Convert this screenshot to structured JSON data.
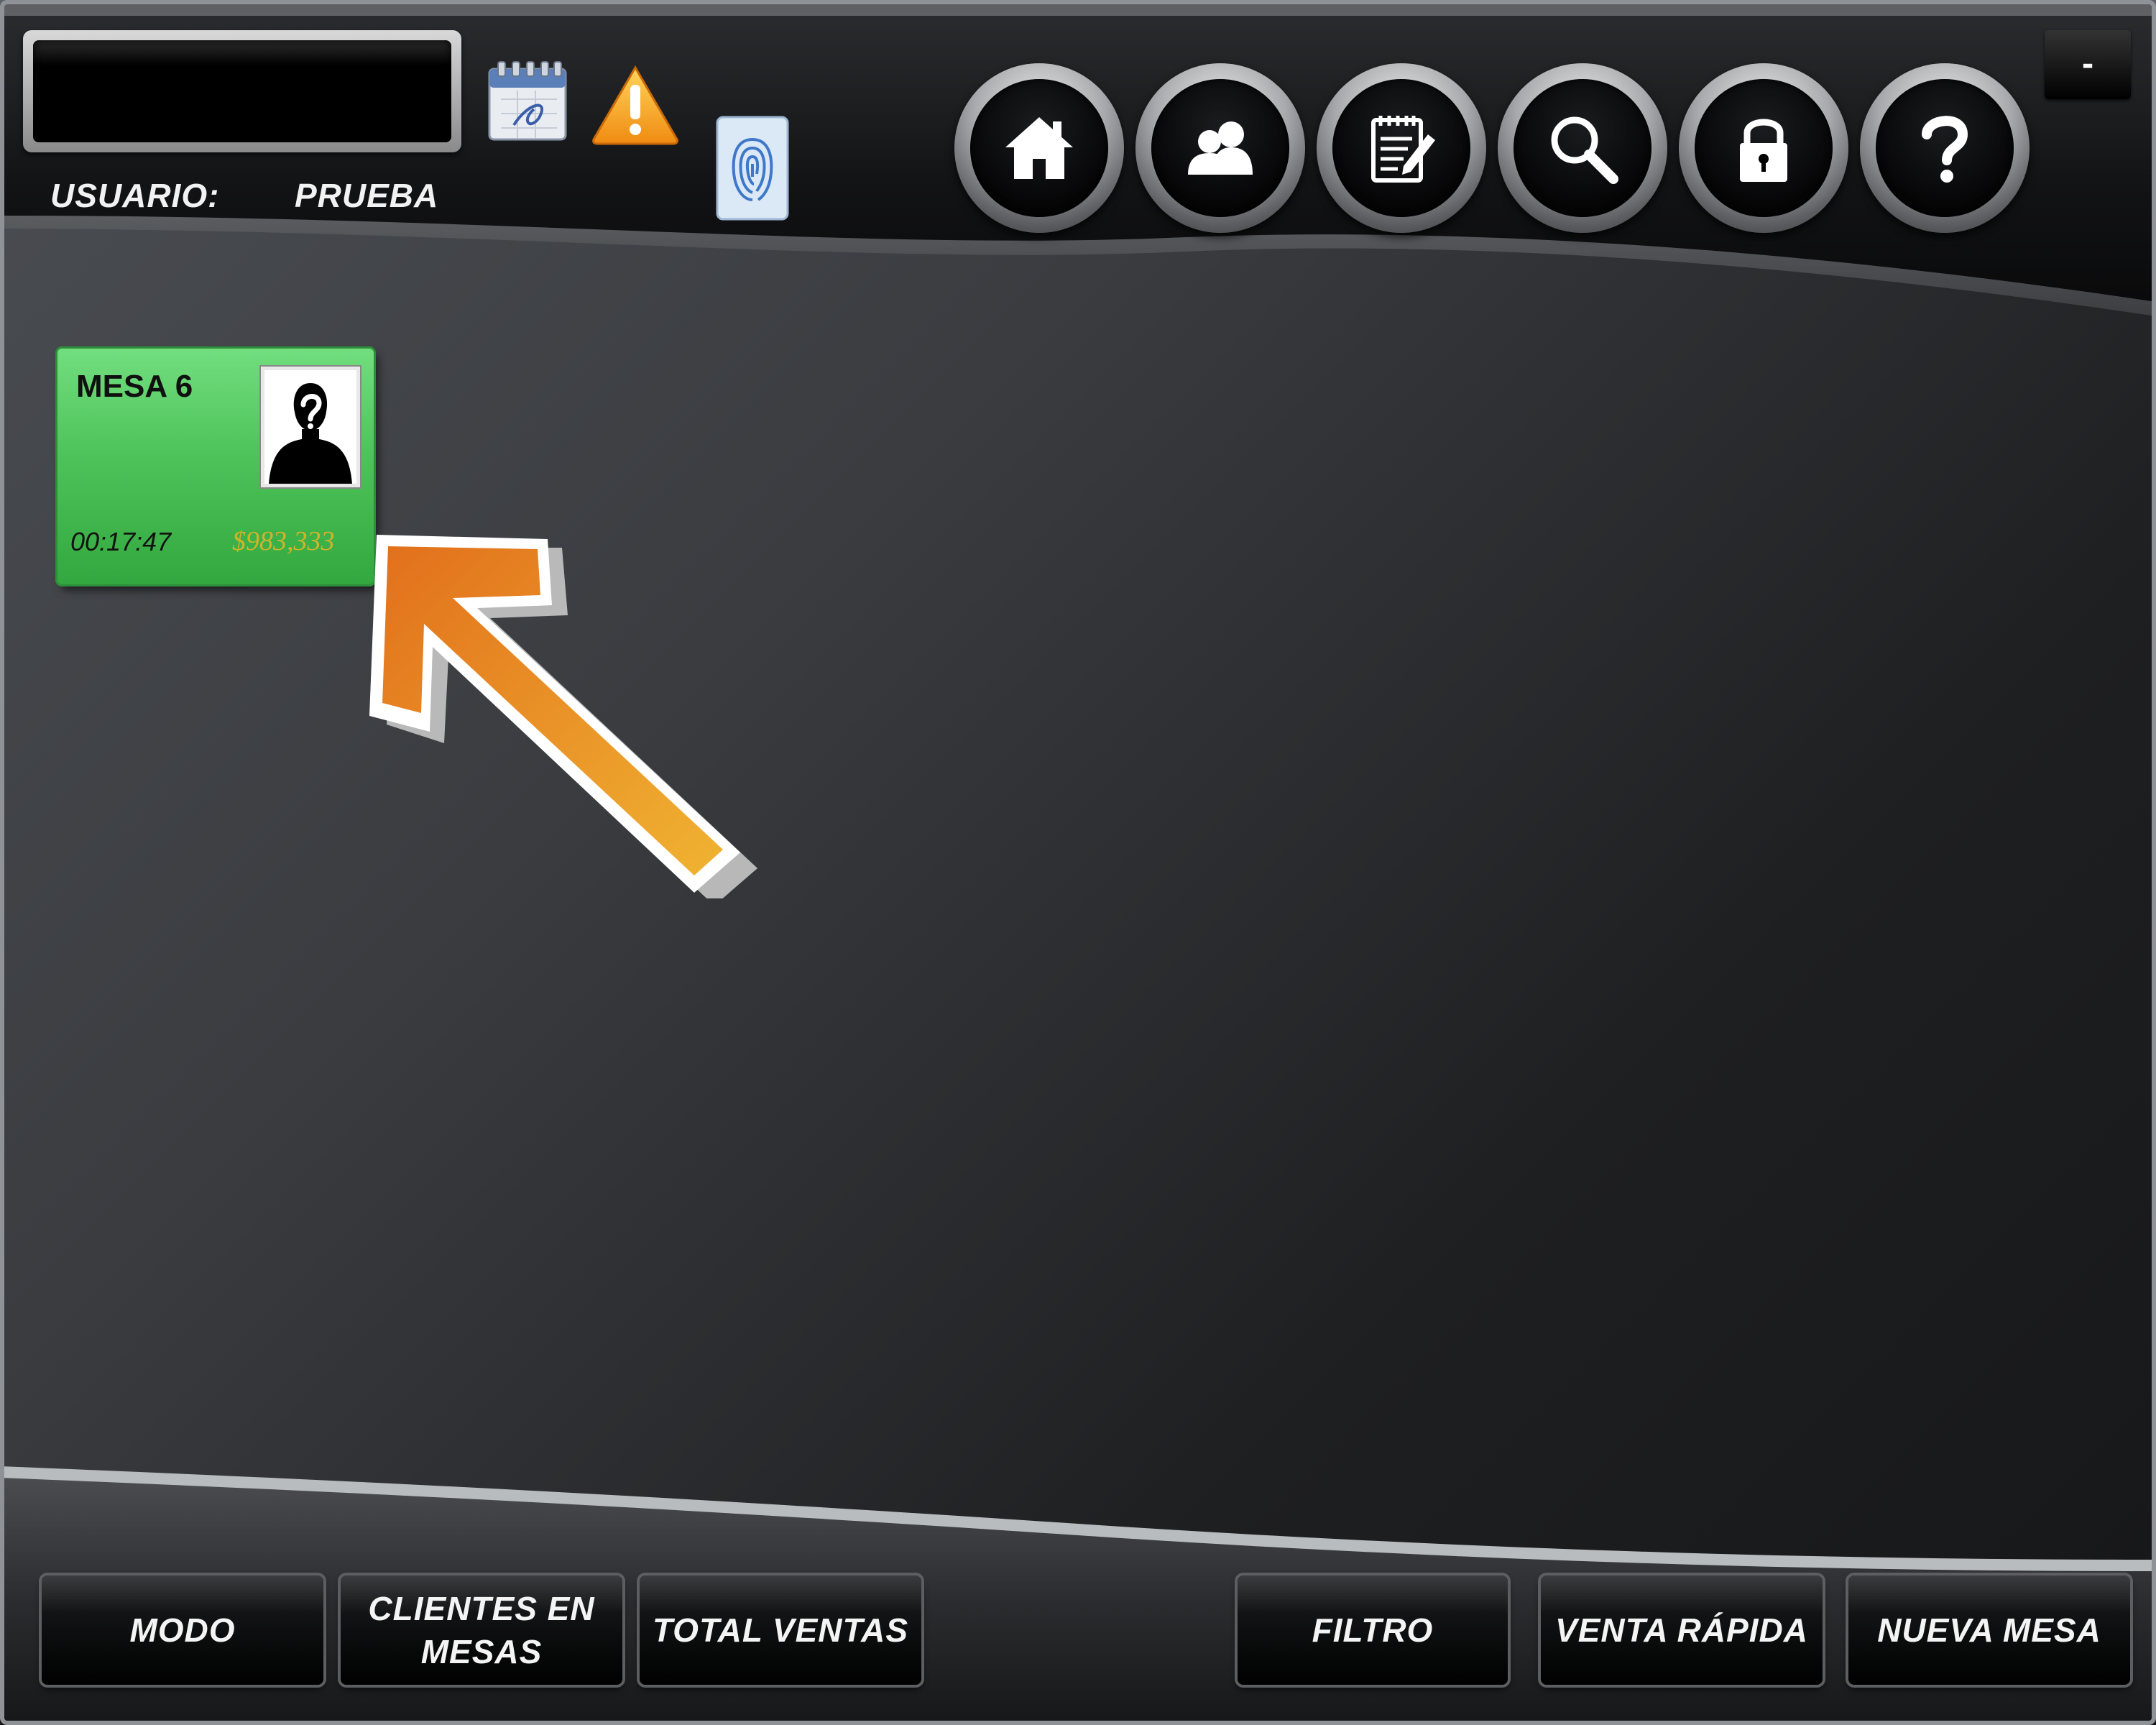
{
  "header": {
    "user_label": "USUARIO:",
    "user_value": "PRUEBA",
    "minimize_label": "-",
    "status_icons": [
      "calendar-icon",
      "warning-icon",
      "fingerprint-icon"
    ],
    "nav_buttons": [
      "home-icon",
      "clients-icon",
      "notes-icon",
      "search-icon",
      "lock-icon",
      "help-icon"
    ]
  },
  "tables": [
    {
      "name": "MESA 6",
      "time": "00:17:47",
      "total": "$983,333",
      "status_color": "#4ec35a"
    }
  ],
  "footer": {
    "buttons": [
      {
        "label_lines": [
          "MODO"
        ]
      },
      {
        "label_lines": [
          "CLIENTES EN",
          "MESAS"
        ]
      },
      {
        "label_lines": [
          "TOTAL VENTAS"
        ]
      },
      {
        "label_lines": [
          "FILTRO"
        ]
      },
      {
        "label_lines": [
          "VENTA RÁPIDA"
        ]
      },
      {
        "label_lines": [
          "NUEVA MESA"
        ]
      }
    ]
  },
  "colors": {
    "accent_arrow": "#e8932a",
    "table_active": "#4ec35a",
    "amount_text": "#d1b32a"
  }
}
